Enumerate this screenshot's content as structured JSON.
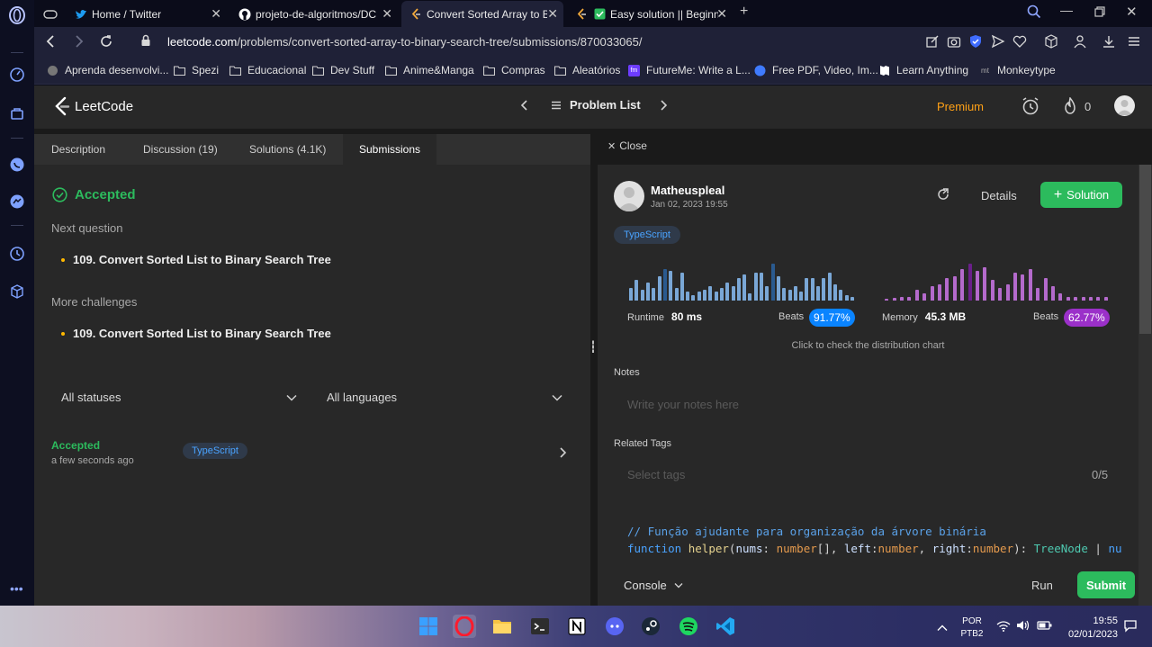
{
  "browser": {
    "tabs": [
      {
        "label": "Home / Twitter",
        "icon": "twitter-icon"
      },
      {
        "label": "projeto-de-algoritmos/DC",
        "icon": "github-icon"
      },
      {
        "label": "Convert Sorted Array to Bin",
        "icon": "leetcode-icon"
      },
      {
        "label": "Easy solution || Beginne",
        "icon": "checkbox-icon"
      }
    ],
    "url_host": "leetcode.com",
    "url_path": "/problems/convert-sorted-array-to-binary-search-tree/submissions/870033065/",
    "bookmarks": [
      "Aprenda desenvolvi...",
      "Spezi",
      "Educacional",
      "Dev Stuff",
      "Anime&Manga",
      "Compras",
      "Aleatórios",
      "FutureMe: Write a L...",
      "Free PDF, Video, Im...",
      "Learn Anything",
      "Monkeytype"
    ],
    "accent": "#f2a93b"
  },
  "lc": {
    "logo": "LeetCode",
    "problem_list": "Problem List",
    "premium": "Premium",
    "streak": "0",
    "tabs": [
      "Description",
      "Discussion (19)",
      "Solutions (4.1K)",
      "Submissions"
    ],
    "close_label": "Close"
  },
  "left": {
    "status": "Accepted",
    "next_question_title": "Next question",
    "next_question": "109. Convert Sorted List to Binary Search Tree",
    "more_challenges_title": "More challenges",
    "more_challenge": "109. Convert Sorted List to Binary Search Tree",
    "filter_status": "All statuses",
    "filter_language": "All languages",
    "submission": {
      "status": "Accepted",
      "time": "a few seconds ago",
      "language": "TypeScript"
    }
  },
  "right": {
    "user": "Matheuspleal",
    "date": "Jan 02, 2023 19:55",
    "details": "Details",
    "solution": "Solution",
    "language": "TypeScript",
    "runtime_label": "Runtime",
    "runtime_value": "80 ms",
    "runtime_beats_label": "Beats",
    "runtime_beats": "91.77%",
    "memory_label": "Memory",
    "memory_value": "45.3 MB",
    "memory_beats_label": "Beats",
    "memory_beats": "62.77%",
    "dist_hint": "Click to check the distribution chart",
    "notes_label": "Notes",
    "notes_placeholder": "Write your notes here",
    "tags_label": "Related Tags",
    "tags_placeholder": "Select tags",
    "tags_count": "0/5",
    "code_line1": "// Função ajudante para organização da árvore binária",
    "code_kw_function": "function",
    "code_fn": "helper",
    "code_p_nums": "nums",
    "code_t_number": "number",
    "code_p_left": "left",
    "code_p_right": "right",
    "code_t_treenode": "TreeNode",
    "code_trunc": "nu",
    "console": "Console",
    "run": "Run",
    "submit": "Submit"
  },
  "runtime_hist": [
    0.35,
    0.55,
    0.3,
    0.5,
    0.35,
    0.65,
    0.85,
    0.8,
    0.35,
    0.75,
    0.25,
    0.15,
    0.25,
    0.3,
    0.4,
    0.25,
    0.35,
    0.5,
    0.4,
    0.6,
    0.7,
    0.2,
    0.75,
    0.75,
    0.4,
    1.0,
    0.65,
    0.35,
    0.3,
    0.4,
    0.25,
    0.6,
    0.6,
    0.4,
    0.6,
    0.75,
    0.45,
    0.3,
    0.15,
    0.1
  ],
  "runtime_highlight": [
    6,
    25
  ],
  "memory_hist": [
    0.05,
    0.07,
    0.1,
    0.1,
    0.3,
    0.2,
    0.4,
    0.45,
    0.6,
    0.65,
    0.85,
    1.0,
    0.8,
    0.9,
    0.55,
    0.35,
    0.45,
    0.75,
    0.7,
    0.85,
    0.35,
    0.6,
    0.4,
    0.2,
    0.1,
    0.1,
    0.1,
    0.1,
    0.1,
    0.1
  ],
  "memory_highlight": 11,
  "colors": {
    "green": "#2cbb5d",
    "blue_badge": "#0a84ff",
    "purple_badge": "#9b30c9",
    "runtime_bar": "#7aa7d6",
    "runtime_bar_hi": "#2a5a8f",
    "memory_bar": "#b46acc",
    "memory_bar_hi": "#6a1f8a",
    "premium": "#ffa116"
  },
  "taskbar": {
    "lang1": "POR",
    "lang2": "PTB2",
    "time": "19:55",
    "date": "02/01/2023"
  }
}
